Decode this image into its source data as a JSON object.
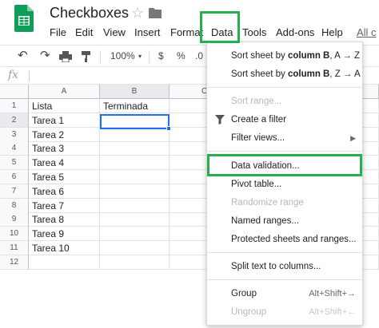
{
  "header": {
    "title": "Checkboxes",
    "menu": [
      "File",
      "Edit",
      "View",
      "Insert",
      "Format",
      "Data",
      "Tools",
      "Add-ons",
      "Help"
    ],
    "all_changes": "All c"
  },
  "toolbar": {
    "zoom": "100%",
    "currency": "$",
    "percent": "%",
    "decimal": ".0"
  },
  "formula_bar": {
    "fx": "fx"
  },
  "grid": {
    "columns": [
      "A",
      "B",
      "C"
    ],
    "rows": [
      "1",
      "2",
      "3",
      "4",
      "5",
      "6",
      "7",
      "8",
      "9",
      "10",
      "11",
      "12"
    ],
    "cells_a": [
      "Lista",
      "Tarea 1",
      "Tarea 2",
      "Tarea 3",
      "Tarea 4",
      "Tarea 5",
      "Tarea 6",
      "Tarea 7",
      "Tarea 8",
      "Tarea 9",
      "Tarea 10",
      ""
    ],
    "cell_b1": "Terminada"
  },
  "data_menu": {
    "sort_az_prefix": "Sort sheet by ",
    "sort_col": "column B",
    "sort_az_suffix": ", A → Z",
    "sort_za_suffix": ", Z → A",
    "sort_range": "Sort range...",
    "create_filter": "Create a filter",
    "filter_views": "Filter views...",
    "data_validation": "Data validation...",
    "pivot_table": "Pivot table...",
    "randomize_range": "Randomize range",
    "named_ranges": "Named ranges...",
    "protected": "Protected sheets and ranges...",
    "split_text": "Split text to columns...",
    "group": "Group",
    "group_shortcut": "Alt+Shift+→",
    "ungroup": "Ungroup",
    "ungroup_shortcut": "Alt+Shift+←"
  },
  "colors": {
    "highlight": "#22b14c",
    "selection": "#1a73e8",
    "sheets_green": "#0f9d58"
  }
}
